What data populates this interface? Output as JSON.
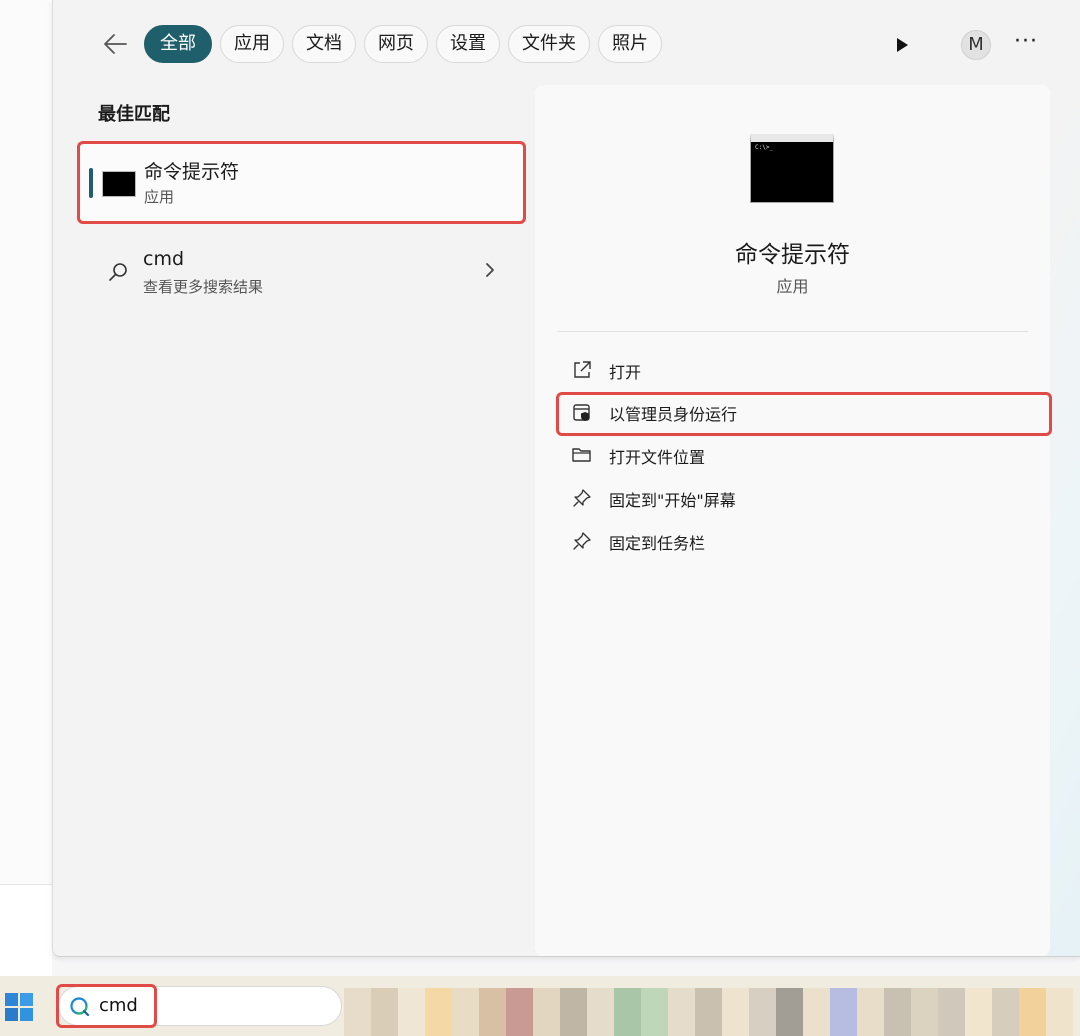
{
  "filters": {
    "back_label": "←",
    "chips": [
      {
        "label": "全部",
        "active": true
      },
      {
        "label": "应用"
      },
      {
        "label": "文档"
      },
      {
        "label": "网页"
      },
      {
        "label": "设置"
      },
      {
        "label": "文件夹"
      },
      {
        "label": "照片"
      }
    ],
    "avatar_letter": "M",
    "more_label": "···"
  },
  "results": {
    "section_title": "最佳匹配",
    "best_match": {
      "title": "命令提示符",
      "subtitle": "应用"
    },
    "web_search": {
      "title": "cmd",
      "subtitle": "查看更多搜索结果"
    }
  },
  "detail": {
    "thumb_text": "C:\\>_",
    "name": "命令提示符",
    "kind": "应用",
    "actions": [
      {
        "label": "打开",
        "icon": "open-external-icon"
      },
      {
        "label": "以管理员身份运行",
        "icon": "shield-admin-icon"
      },
      {
        "label": "打开文件位置",
        "icon": "folder-icon"
      },
      {
        "label": "固定到\"开始\"屏幕",
        "icon": "pin-icon"
      },
      {
        "label": "固定到任务栏",
        "icon": "pin-icon"
      }
    ]
  },
  "taskbar": {
    "search_value": "cmd",
    "block_colors": [
      "#e7dcc9",
      "#d9cdb8",
      "#efe6d5",
      "#f4d9a6",
      "#e9dcc4",
      "#d8c0a4",
      "#c99a93",
      "#e2d6c1",
      "#bfb6a5",
      "#e5dccb",
      "#a9c6a8",
      "#bfd6b8",
      "#e6dccb",
      "#c9c0b0",
      "#eee3ce",
      "#d7d0c2",
      "#a39e95",
      "#eae0cc",
      "#b6bde0",
      "#e8ddc8",
      "#c8c0b1",
      "#dcd2c0",
      "#cfc8bb",
      "#f1e5cd",
      "#d6cdbd",
      "#f2d19a",
      "#efe3cc"
    ],
    "accent_highlight": "#e04a47",
    "accent_primary": "#1f5f6b"
  }
}
